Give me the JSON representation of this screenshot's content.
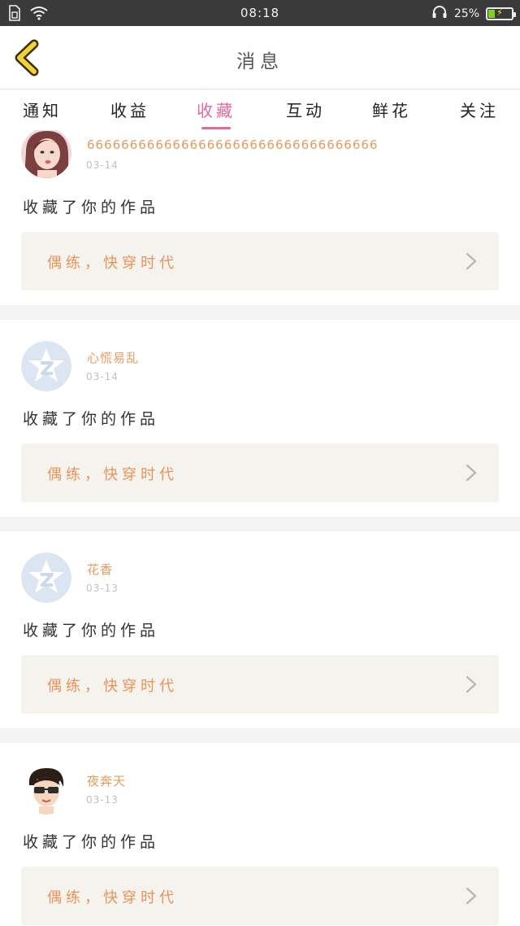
{
  "status_bar": {
    "time": "08:18",
    "battery_percent": "25%",
    "battery_level": 0.25,
    "icons": [
      "sim-icon",
      "wifi-icon",
      "headset-icon",
      "battery-icon"
    ]
  },
  "header": {
    "title": "消息",
    "back_icon": "chevron-left-icon"
  },
  "tabs": [
    {
      "label": "通知",
      "active": false
    },
    {
      "label": "收益",
      "active": false
    },
    {
      "label": "收藏",
      "active": true
    },
    {
      "label": "互动",
      "active": false
    },
    {
      "label": "鲜花",
      "active": false
    },
    {
      "label": "关注",
      "active": false
    }
  ],
  "colors": {
    "accent": "#e06a98",
    "username": "#e59b5c",
    "work_title": "#e8935a",
    "work_box_bg": "#f4f3ee",
    "status_bar_bg": "#3a3a3a"
  },
  "messages": [
    {
      "username": "6666666666666666666666666666666666",
      "date": "03-14",
      "action": "收藏了你的作品",
      "work_title": "偶练，快穿时代",
      "avatar": "photo-avatar-girl"
    },
    {
      "username": "心慌易乱",
      "date": "03-14",
      "action": "收藏了你的作品",
      "work_title": "偶练，快穿时代",
      "avatar": "qzone-default-avatar"
    },
    {
      "username": "花香",
      "date": "03-13",
      "action": "收藏了你的作品",
      "work_title": "偶练，快穿时代",
      "avatar": "qzone-default-avatar"
    },
    {
      "username": "夜奔天",
      "date": "03-13",
      "action": "收藏了你的作品",
      "work_title": "偶练，快穿时代",
      "avatar": "cartoon-avatar-boy"
    }
  ]
}
